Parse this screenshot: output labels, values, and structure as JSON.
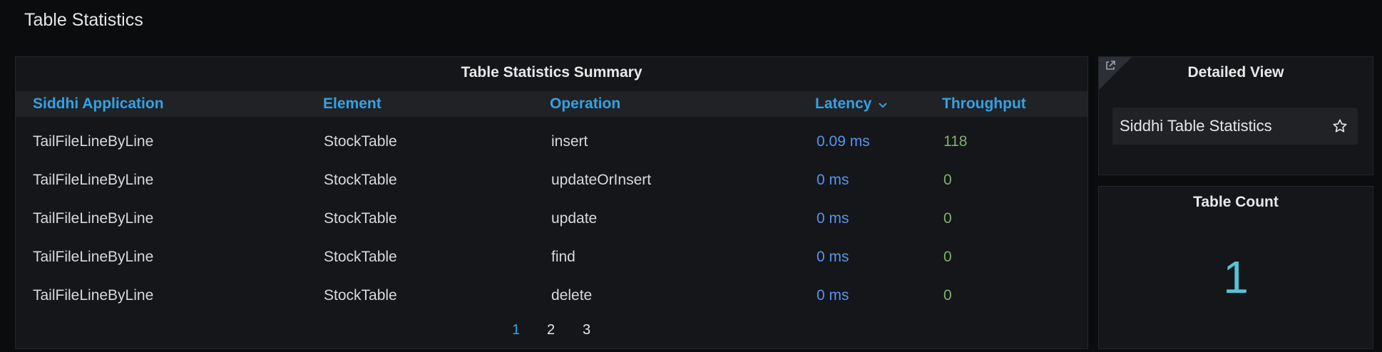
{
  "row": {
    "title": "Table Statistics"
  },
  "summary": {
    "title": "Table Statistics Summary",
    "columns": [
      "Siddhi Application",
      "Element",
      "Operation",
      "Latency",
      "Throughput"
    ],
    "rows": [
      [
        "TailFileLineByLine",
        "StockTable",
        "insert",
        "0.09 ms",
        "118"
      ],
      [
        "TailFileLineByLine",
        "StockTable",
        "updateOrInsert",
        "0 ms",
        "0"
      ],
      [
        "TailFileLineByLine",
        "StockTable",
        "update",
        "0 ms",
        "0"
      ],
      [
        "TailFileLineByLine",
        "StockTable",
        "find",
        "0 ms",
        "0"
      ],
      [
        "TailFileLineByLine",
        "StockTable",
        "delete",
        "0 ms",
        "0"
      ]
    ],
    "sort": {
      "column": "Latency",
      "direction": "desc"
    },
    "pages": [
      "1",
      "2",
      "3"
    ],
    "current_page": "1"
  },
  "detail": {
    "title": "Detailed View",
    "link_label": "Siddhi Table Statistics"
  },
  "count": {
    "title": "Table Count",
    "value": "1"
  },
  "colors": {
    "background": "#0b0c0e",
    "panel": "#141619",
    "header_text": "#33a2e5",
    "latency": "#5794f2",
    "throughput": "#7eb26d",
    "stat": "#56c3d6"
  },
  "icons": [
    "external-link-icon",
    "star-icon",
    "chevron-down-icon"
  ]
}
